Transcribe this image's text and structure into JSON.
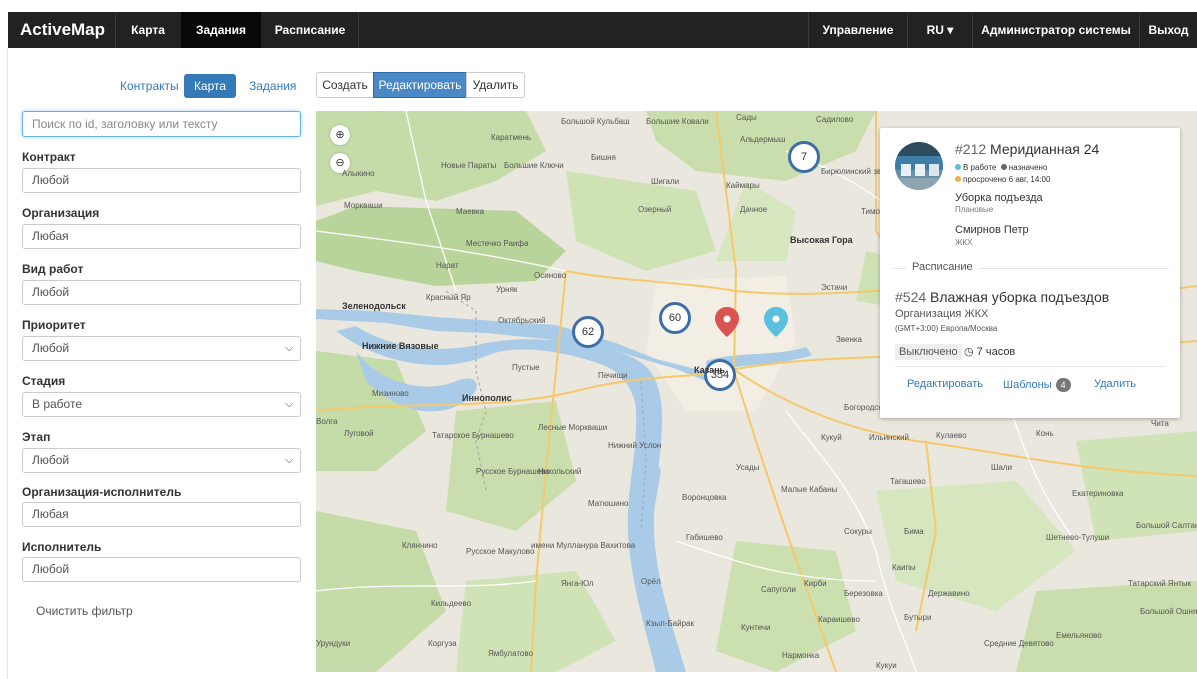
{
  "navbar": {
    "brand": "ActiveMap",
    "items": [
      "Карта",
      "Задания",
      "Расписание"
    ],
    "right": [
      "Управление",
      "RU ▾",
      "Администратор системы",
      "Выход"
    ]
  },
  "subnav": {
    "tabs": [
      "Контракты",
      "Карта",
      "Задания"
    ]
  },
  "toolbar": {
    "create": "Создать",
    "edit": "Редактировать",
    "delete": "Удалить"
  },
  "filters": {
    "search_placeholder": "Поиск по id, заголовку или тексту",
    "contract": {
      "label": "Контракт",
      "value": "Любой"
    },
    "organization": {
      "label": "Организация",
      "value": "Любая"
    },
    "work_type": {
      "label": "Вид работ",
      "value": "Любой"
    },
    "priority": {
      "label": "Приоритет",
      "value": "Любой"
    },
    "stage": {
      "label": "Стадия",
      "value": "В работе"
    },
    "phase": {
      "label": "Этап",
      "value": "Любой"
    },
    "executor_org": {
      "label": "Организация-исполнитель",
      "value": "Любая"
    },
    "executor": {
      "label": "Исполнитель",
      "value": "Любой"
    },
    "clear": "Очистить фильтр"
  },
  "map": {
    "zoom_in": "⊕",
    "zoom_out": "⊖",
    "clusters": [
      "7",
      "60",
      "62",
      "354"
    ],
    "labels": [
      "Большой Кульбаш",
      "Большие Ковали",
      "Сады",
      "Садилово",
      "Каратмень",
      "Альдермыш",
      "Новые Параты",
      "Большие Ключи",
      "Бишня",
      "Шигали",
      "Каймары",
      "Бирюлинский зверосовхоз",
      "Моркваши",
      "Маевка",
      "Озерный",
      "Дачное",
      "Тимо",
      "Местечко Раифа",
      "Высокая Гора",
      "Нарат",
      "Осиново",
      "Урняк",
      "Эстачи",
      "Зеленодольск",
      "Красный Яр",
      "Октябрьский",
      "Нижние Вязовые",
      "Пустые",
      "Печищи",
      "Звенка",
      "Мизиново",
      "Иннополис",
      "Богородское",
      "Луговой",
      "Татарское Бурнашево",
      "Лесные Моркваши",
      "Нижний Услон",
      "Кукуй",
      "Ильинский",
      "Кулаево",
      "Конь",
      "Чита",
      "Волга",
      "Русское Бурнашево",
      "Никольский",
      "Усады",
      "Тагашево",
      "Шали",
      "Екатериновка",
      "Воронцовка",
      "Малые Кабаны",
      "Матюшино",
      "Сокуры",
      "Бима",
      "Большой Салтан",
      "Шетнево-Тулуши",
      "Клянчино",
      "Русское Макулово",
      "имени Мулланура Вахитова",
      "Габишево",
      "Каипы",
      "Янга-Юл",
      "Орёл",
      "Сапуголи",
      "Кирби",
      "Березовка",
      "Державино",
      "Татарский Янтык",
      "Кильдеево",
      "Кзыл-Байрак",
      "Кунтечи",
      "Караишево",
      "Бутыри",
      "Емельяново",
      "Большой Ошняк",
      "Средние Девятово",
      "Коргуза",
      "Ямбулатово",
      "Нармонка",
      "Кукуи",
      "Урундуки",
      "Алыкино",
      "Казань"
    ]
  },
  "card": {
    "task_id": "#212",
    "task_title": "Меридианная 24",
    "status_work": "В работе",
    "status_assigned": "назначено",
    "overdue": "просрочено 6 авг, 14:00",
    "category": "Уборка подъезда",
    "subcategory": "Плановые",
    "person": "Смирнов Петр",
    "person_org": "ЖКХ",
    "legend": "Расписание",
    "schedule_id": "#524",
    "schedule_title": "Влажная уборка подъездов",
    "org_prefix": "Организация",
    "org_name": "ЖКХ",
    "timezone": "(GMT+3:00) Европа/Москва",
    "disabled": "Выключено",
    "duration": "7 часов",
    "edit": "Редактировать",
    "templates": "Шаблоны",
    "templates_count": "4",
    "delete": "Удалить"
  },
  "colors": {
    "accent": "#337ab7",
    "status_work": "#5bc0de",
    "status_assigned": "#666666",
    "overdue": "#f0ad4e",
    "marker_red": "#d9534f",
    "marker_blue": "#5bc0de",
    "cluster_border": "#3e6ea8"
  }
}
